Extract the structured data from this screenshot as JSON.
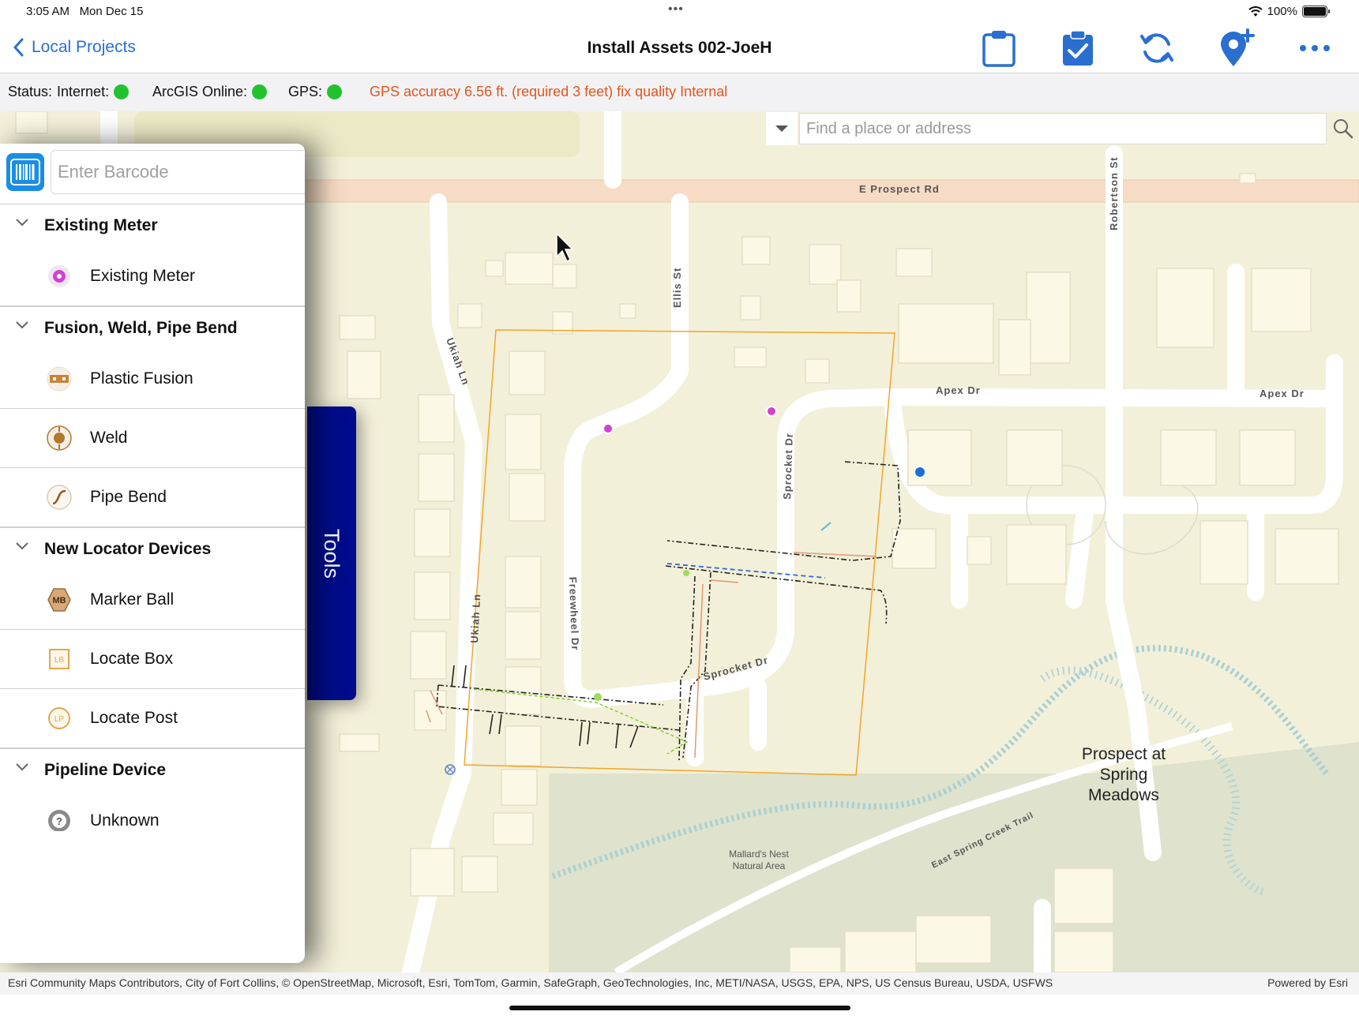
{
  "status_bar": {
    "time": "3:05 AM",
    "date": "Mon Dec 15",
    "battery": "100%"
  },
  "nav": {
    "back_label": "Local Projects",
    "title": "Install Assets 002-JoeH",
    "icons": [
      "clipboard-icon",
      "checklist-icon",
      "sync-icon",
      "add-location-icon",
      "more-icon"
    ]
  },
  "status_line": {
    "status_label": "Status:",
    "internet_label": "Internet:",
    "arcgis_label": "ArcGIS Online:",
    "gps_label": "GPS:",
    "gps_message": "GPS accuracy 6.56 ft. (required 3 feet) fix quality Internal",
    "indicator_color": "#22c22e"
  },
  "search": {
    "placeholder": "Find a place or address"
  },
  "barcode": {
    "placeholder": "Enter Barcode"
  },
  "panel": {
    "sections": [
      {
        "title": "Existing Meter",
        "items": [
          {
            "label": "Existing Meter",
            "icon": "meter-icon"
          }
        ]
      },
      {
        "title": "Fusion, Weld, Pipe Bend",
        "items": [
          {
            "label": "Plastic Fusion",
            "icon": "plastic-fusion-icon"
          },
          {
            "label": "Weld",
            "icon": "weld-icon"
          },
          {
            "label": "Pipe Bend",
            "icon": "pipe-bend-icon"
          }
        ]
      },
      {
        "title": "New Locator Devices",
        "items": [
          {
            "label": "Marker Ball",
            "icon": "marker-ball-icon",
            "badge": "MB"
          },
          {
            "label": "Locate Box",
            "icon": "locate-box-icon",
            "badge": "LB"
          },
          {
            "label": "Locate Post",
            "icon": "locate-post-icon",
            "badge": "LP"
          }
        ]
      },
      {
        "title": "Pipeline Device",
        "items": [
          {
            "label": "Unknown",
            "icon": "unknown-device-icon"
          }
        ]
      }
    ]
  },
  "tools_label": "Tools",
  "map": {
    "streets": {
      "prospect": "E Prospect Rd",
      "robertson": "Robertson St",
      "ellis": "Ellis St",
      "ukiah": "Ukiah Ln",
      "ukiah2": "Ukiah Ln",
      "apex1": "Apex Dr",
      "apex2": "Apex Dr",
      "sprocket1": "Sprocket Dr",
      "sprocket2": "Sprocket Dr",
      "freewheel": "Freewheel Dr",
      "trail": "East Spring Creek Trail"
    },
    "places": {
      "prospect_meadows_1": "Prospect at",
      "prospect_meadows_2": "Spring",
      "prospect_meadows_3": "Meadows",
      "mallards_1": "Mallard's Nest",
      "mallards_2": "Natural Area"
    }
  },
  "attribution": {
    "left": "Esri Community Maps Contributors, City of Fort Collins, © OpenStreetMap, Microsoft, Esri, TomTom, Garmin, SafeGraph, GeoTechnologies, Inc, METI/NASA, USGS, EPA, NPS, US Census Bureau, USDA, USFWS",
    "right": "Powered by Esri"
  }
}
